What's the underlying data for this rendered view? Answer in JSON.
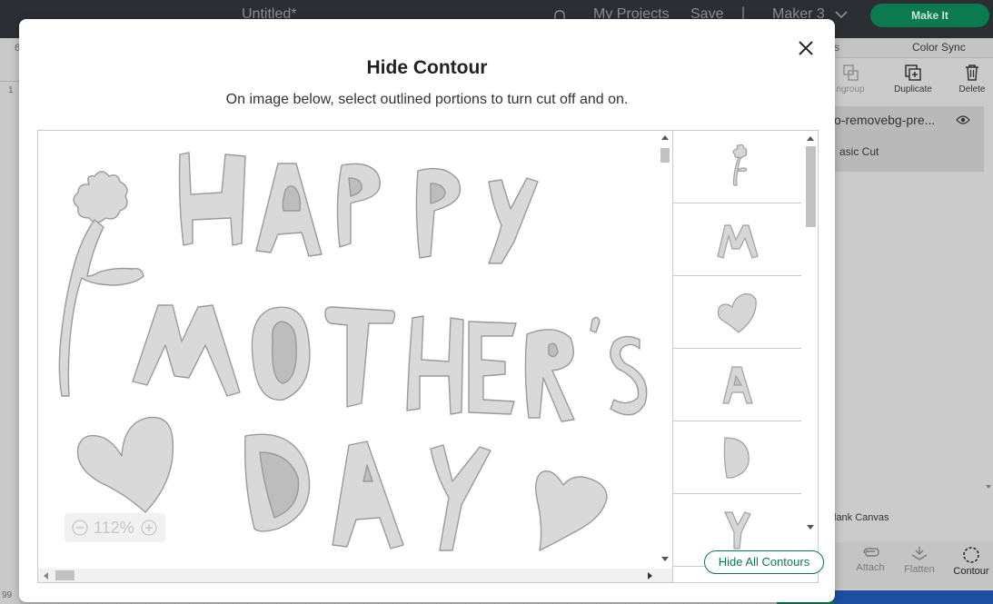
{
  "app": {
    "document_title": "Untitled*",
    "nav": {
      "my_projects": "My Projects",
      "save": "Save",
      "separator": "|",
      "machine": "Maker 3",
      "make_it": "Make It"
    },
    "ruler": {
      "top_fragment": "6",
      "left_tick": "1",
      "bottom_fragment": "99"
    },
    "right_panel": {
      "tab_fragment": "s",
      "tab_color_sync": "Color Sync",
      "tools": {
        "ungroup": "ngroup",
        "duplicate": "Duplicate",
        "delete": "Delete"
      },
      "layer_name": "o-removebg-pre...",
      "layer_operation": "asic Cut",
      "blank_canvas": "lank Canvas",
      "bottom_tools": {
        "attach": "Attach",
        "flatten": "Flatten",
        "contour": "Contour"
      }
    }
  },
  "modal": {
    "title": "Hide Contour",
    "subtitle": "On image below, select outlined portions to turn cut off and on.",
    "zoom_level": "112%",
    "thumbnails": [
      "flower",
      "letter-M",
      "heart",
      "letter-A",
      "letter-D",
      "letter-Y"
    ],
    "hide_all_label": "Hide All Contours"
  },
  "colors": {
    "accent": "#0c7a4f",
    "contour_fill": "#d9d9d9",
    "contour_stroke": "#9a9a9a",
    "inner_fill": "#bdbdbd",
    "topbar": "#2b2f33"
  }
}
